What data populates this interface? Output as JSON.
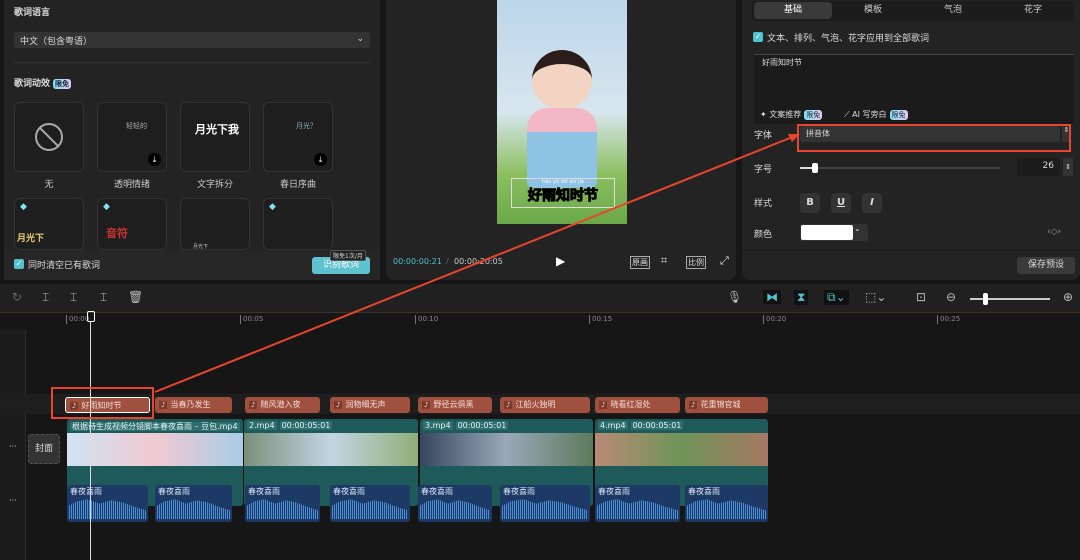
{
  "left": {
    "lang_title": "歌词语言",
    "lang_value": "中文（包含粤语）",
    "effects_title": "歌词动效",
    "effects_badge": "限免",
    "effects": [
      {
        "name": "无",
        "preview": ""
      },
      {
        "name": "透明情绪",
        "preview": "轻轻的"
      },
      {
        "name": "文字拆分",
        "preview": "月光下我"
      },
      {
        "name": "春日序曲",
        "preview": "月光？"
      },
      {
        "name": "",
        "preview": "月光下"
      },
      {
        "name": "",
        "preview": "音符"
      },
      {
        "name": "",
        "preview": "月光下"
      },
      {
        "name": "",
        "preview": ""
      }
    ],
    "clear_label": "同时清空已有歌词",
    "recognize_label": "识别歌词",
    "recognize_badge": "限免1次/月"
  },
  "preview": {
    "subtitle": "好雨知时节",
    "pinyin": "hǎo yǔ zhī shí jié",
    "current_time": "00:00:00:21",
    "total_time": "00:00:20:05",
    "btn_original": "原画",
    "btn_ratio": "比例"
  },
  "right": {
    "tabs": [
      "基础",
      "模板",
      "气泡",
      "花字"
    ],
    "apply_all": "文本、排列、气泡、花字应用到全部歌词",
    "text_value": "好雨知时节",
    "copy_suggest": "文案推荐",
    "ai_narration": "AI 写旁白",
    "badge": "限免",
    "font_label": "字体",
    "font_value": "拼音体",
    "size_label": "字号",
    "size_value": "26",
    "size_fraction": 0.08,
    "style_label": "样式",
    "style_buttons": [
      "B",
      "U",
      "I"
    ],
    "color_label": "颜色",
    "color_value": "#ffffff",
    "save_preset": "保存预设"
  },
  "timeline": {
    "ticks": [
      "00:00",
      "00:05",
      "00:10",
      "00:15",
      "00:20",
      "00:25"
    ],
    "cover_label": "封面",
    "more": "···",
    "subtitles": [
      "好雨知时节",
      "当春乃发生",
      "随风潜入夜",
      "润物细无声",
      "野径云俱黑",
      "江船火独明",
      "晓看红湿处",
      "花重锦官城"
    ],
    "videos": [
      {
        "name": "根据诗生成视频分镜脚本春夜喜雨 – 豆包.mp4",
        "duration": ""
      },
      {
        "name": "2.mp4",
        "duration": "00:00:05:01"
      },
      {
        "name": "3.mp4",
        "duration": "00:00:05:01"
      },
      {
        "name": "4.mp4",
        "duration": "00:00:05:01"
      }
    ],
    "audio": [
      "春夜喜雨",
      "春夜喜雨",
      "春夜喜雨",
      "春夜喜雨",
      "春夜喜雨",
      "春夜喜雨",
      "春夜喜雨",
      "春夜喜雨"
    ],
    "accent": "#4fc3cf",
    "annotation_color": "#e8452c"
  }
}
